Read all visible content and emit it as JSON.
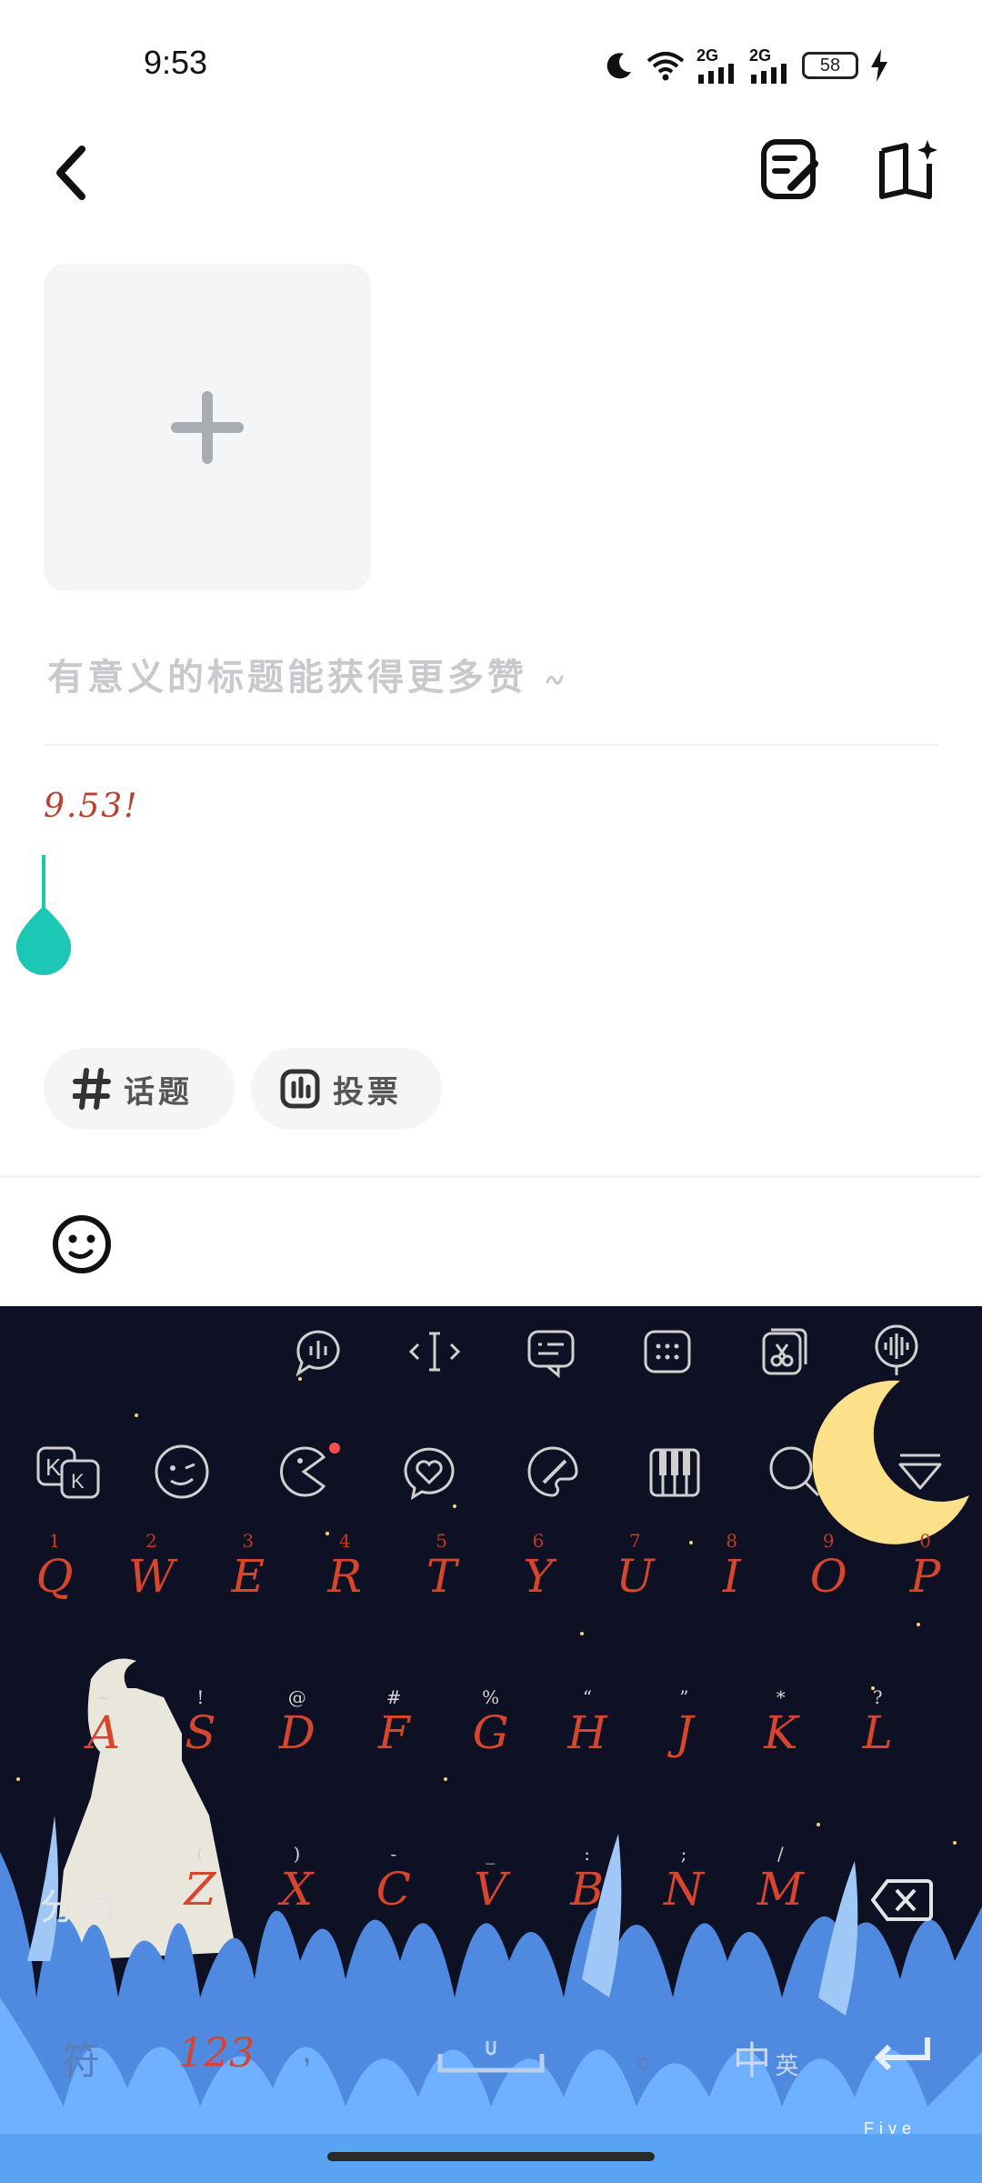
{
  "status_bar": {
    "time": "9:53",
    "battery": "58",
    "signal1": "2G",
    "signal2": "2G"
  },
  "editor": {
    "title_placeholder": "有意义的标题能获得更多赞",
    "body_text": "9.53!",
    "chips": [
      {
        "label": "话题"
      },
      {
        "label": "投票"
      }
    ]
  },
  "keyboard": {
    "row1": [
      {
        "main": "Q",
        "sub": "1"
      },
      {
        "main": "W",
        "sub": "2"
      },
      {
        "main": "E",
        "sub": "3"
      },
      {
        "main": "R",
        "sub": "4"
      },
      {
        "main": "T",
        "sub": "5"
      },
      {
        "main": "Y",
        "sub": "6"
      },
      {
        "main": "U",
        "sub": "7"
      },
      {
        "main": "I",
        "sub": "8"
      },
      {
        "main": "O",
        "sub": "9"
      },
      {
        "main": "P",
        "sub": "0"
      }
    ],
    "row2": [
      {
        "main": "A",
        "sub": "~"
      },
      {
        "main": "S",
        "sub": "!"
      },
      {
        "main": "D",
        "sub": "@"
      },
      {
        "main": "F",
        "sub": "#"
      },
      {
        "main": "G",
        "sub": "%"
      },
      {
        "main": "H",
        "sub": "“"
      },
      {
        "main": "J",
        "sub": "”"
      },
      {
        "main": "K",
        "sub": "*"
      },
      {
        "main": "L",
        "sub": "?"
      }
    ],
    "row3": [
      {
        "main": "Z",
        "sub": "("
      },
      {
        "main": "X",
        "sub": ")"
      },
      {
        "main": "C",
        "sub": "-"
      },
      {
        "main": "V",
        "sub": "_"
      },
      {
        "main": "B",
        "sub": ":"
      },
      {
        "main": "N",
        "sub": ";"
      },
      {
        "main": "M",
        "sub": "/"
      }
    ],
    "fenci_label": "分词",
    "symbol_label": "符",
    "num_label": "123",
    "comma_label": ",",
    "period_label": "。",
    "lang_label": "中",
    "lang_sub": "英",
    "brand": "Five"
  },
  "colors": {
    "accent_teal": "#1cc7b6",
    "key_red": "#d6452c",
    "keyboard_bg": "#0e1023"
  }
}
